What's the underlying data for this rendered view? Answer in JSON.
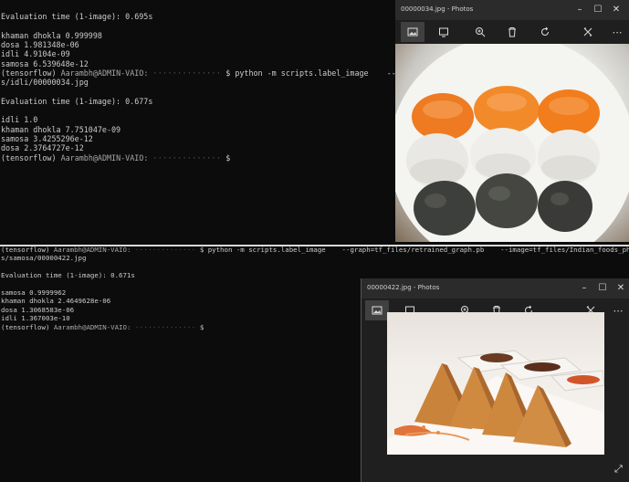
{
  "terminal_top": {
    "lines": [
      {
        "text": "Evaluation time (1-image): 0.695s"
      },
      {
        "text": ""
      },
      {
        "text": "khaman dhokla 0.999998"
      },
      {
        "text": "dosa 1.981348e-06"
      },
      {
        "text": "idli 4.9104e-09"
      },
      {
        "text": "samosa 6.539648e-12"
      },
      {
        "prompt_env": "(tensorflow)",
        "prompt_user": "Aarambh@ADMIN-VAIO:",
        "prompt_path": "··············",
        "command": "$ python -m scripts.label_image    --graph=tf_fil"
      },
      {
        "text": "s/idli/00000034.jpg"
      },
      {
        "text": ""
      },
      {
        "text": "Evaluation time (1-image): 0.677s"
      },
      {
        "text": ""
      },
      {
        "text": "idli 1.0"
      },
      {
        "text": "khaman dhokla 7.751047e-09"
      },
      {
        "text": "samosa 3.4255296e-12"
      },
      {
        "text": "dosa 2.3764727e-12"
      },
      {
        "prompt_env": "(tensorflow)",
        "prompt_user": "Aarambh@ADMIN-VAIO:",
        "prompt_path": "··············",
        "command": "$"
      }
    ]
  },
  "terminal_bottom": {
    "lines": [
      {
        "prompt_env": "(tensorflow)",
        "prompt_user": "Aarambh@ADMIN-VAIO:",
        "prompt_path": "··············",
        "command": "$ python -m scripts.label_image    --graph=tf_files/retrained_graph.pb    --image=tf_files/Indian_foods_photo"
      },
      {
        "text": "s/samosa/00000422.jpg"
      },
      {
        "text": ""
      },
      {
        "text": "Evaluation time (1-image): 0.671s"
      },
      {
        "text": ""
      },
      {
        "text": "samosa 0.9999962"
      },
      {
        "text": "khaman dhokla 2.4649628e-06"
      },
      {
        "text": "dosa 1.3068583e-06"
      },
      {
        "text": "idli 1.367003e-10"
      },
      {
        "prompt_env": "(tensorflow)",
        "prompt_user": "Aarambh@ADMIN-VAIO:",
        "prompt_path": "··············",
        "command": "$"
      }
    ]
  },
  "photos_top": {
    "title": "00000034.jpg - Photos",
    "more": "⋯"
  },
  "photos_bottom": {
    "title": "00000422.jpg - Photos",
    "more": "⋯"
  },
  "colors": {
    "terminal_bg": "#0c0c0c",
    "terminal_text": "#cccccc",
    "photos_chrome": "#1f1f1f",
    "idli_orange": "#f07a1c"
  }
}
